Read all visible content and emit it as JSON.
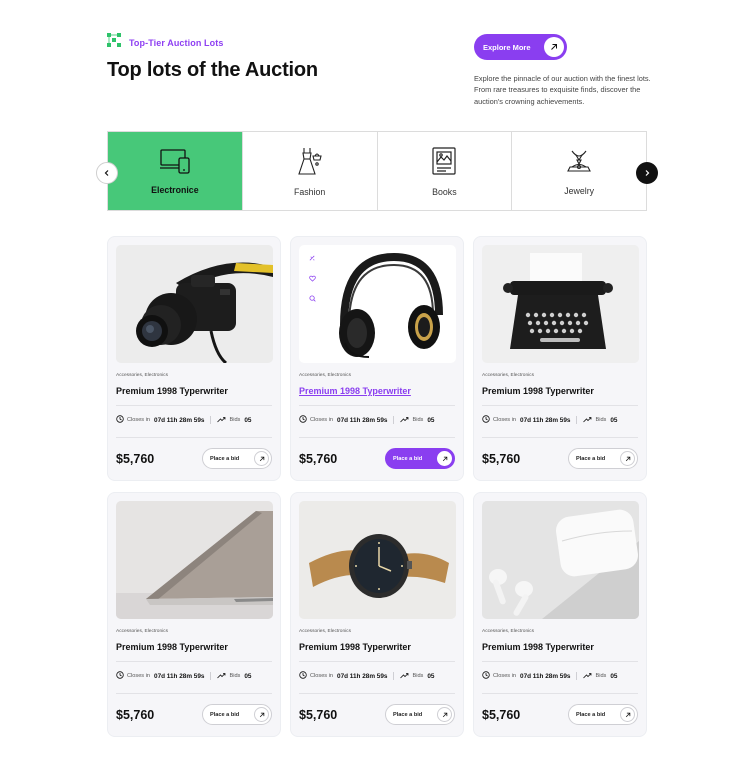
{
  "header": {
    "eyebrow": "Top-Tier Auction Lots",
    "title": "Top lots of the Auction",
    "explore_label": "Explore More",
    "intro": "Explore the pinnacle of our auction with the finest lots. From rare treasures to exquisite finds, discover the auction's crowning achievements."
  },
  "categories": [
    {
      "label": "Electronice",
      "icon": "devices-icon",
      "active": true
    },
    {
      "label": "Fashion",
      "icon": "dress-icon",
      "active": false
    },
    {
      "label": "Books",
      "icon": "picture-book-icon",
      "active": false
    },
    {
      "label": "Jewelry",
      "icon": "jewelry-icon",
      "active": false
    }
  ],
  "products": [
    {
      "image": "camera",
      "meta": "Accessories, Electronics",
      "name": "Premium 1998 Typerwriter",
      "closes_label": "Closes in",
      "closes_value": "07d 11h 28m 59s",
      "bids_label": "Bids",
      "bids_value": "05",
      "price": "$5,760",
      "bid_label": "Place a bid",
      "highlight": false
    },
    {
      "image": "headphones",
      "meta": "Accessories, Electronics",
      "name": "Premium 1998 Typerwriter",
      "closes_label": "Closes in",
      "closes_value": "07d 11h 28m 59s",
      "bids_label": "Bids",
      "bids_value": "05",
      "price": "$5,760",
      "bid_label": "Place a bid",
      "highlight": true
    },
    {
      "image": "typewriter",
      "meta": "Accessories, Electronics",
      "name": "Premium 1998 Typerwriter",
      "closes_label": "Closes in",
      "closes_value": "07d 11h 28m 59s",
      "bids_label": "Bids",
      "bids_value": "05",
      "price": "$5,760",
      "bid_label": "Place a bid",
      "highlight": false
    },
    {
      "image": "laptop",
      "meta": "Accessories, Electronics",
      "name": "Premium 1998 Typerwriter",
      "closes_label": "Closes in",
      "closes_value": "07d 11h 28m 59s",
      "bids_label": "Bids",
      "bids_value": "05",
      "price": "$5,760",
      "bid_label": "Place a bid",
      "highlight": false
    },
    {
      "image": "watch",
      "meta": "Accessories, Electronics",
      "name": "Premium 1998 Typerwriter",
      "closes_label": "Closes in",
      "closes_value": "07d 11h 28m 59s",
      "bids_label": "Bids",
      "bids_value": "05",
      "price": "$5,760",
      "bid_label": "Place a bid",
      "highlight": false
    },
    {
      "image": "earbuds",
      "meta": "Accessories, Electronics",
      "name": "Premium 1998 Typerwriter",
      "closes_label": "Closes in",
      "closes_value": "07d 11h 28m 59s",
      "bids_label": "Bids",
      "bids_value": "05",
      "price": "$5,760",
      "bid_label": "Place a bid",
      "highlight": false
    }
  ],
  "colors": {
    "accent": "#8a3ef0",
    "category_active": "#47c879",
    "eyebrow_icon": "#2ec36a"
  }
}
